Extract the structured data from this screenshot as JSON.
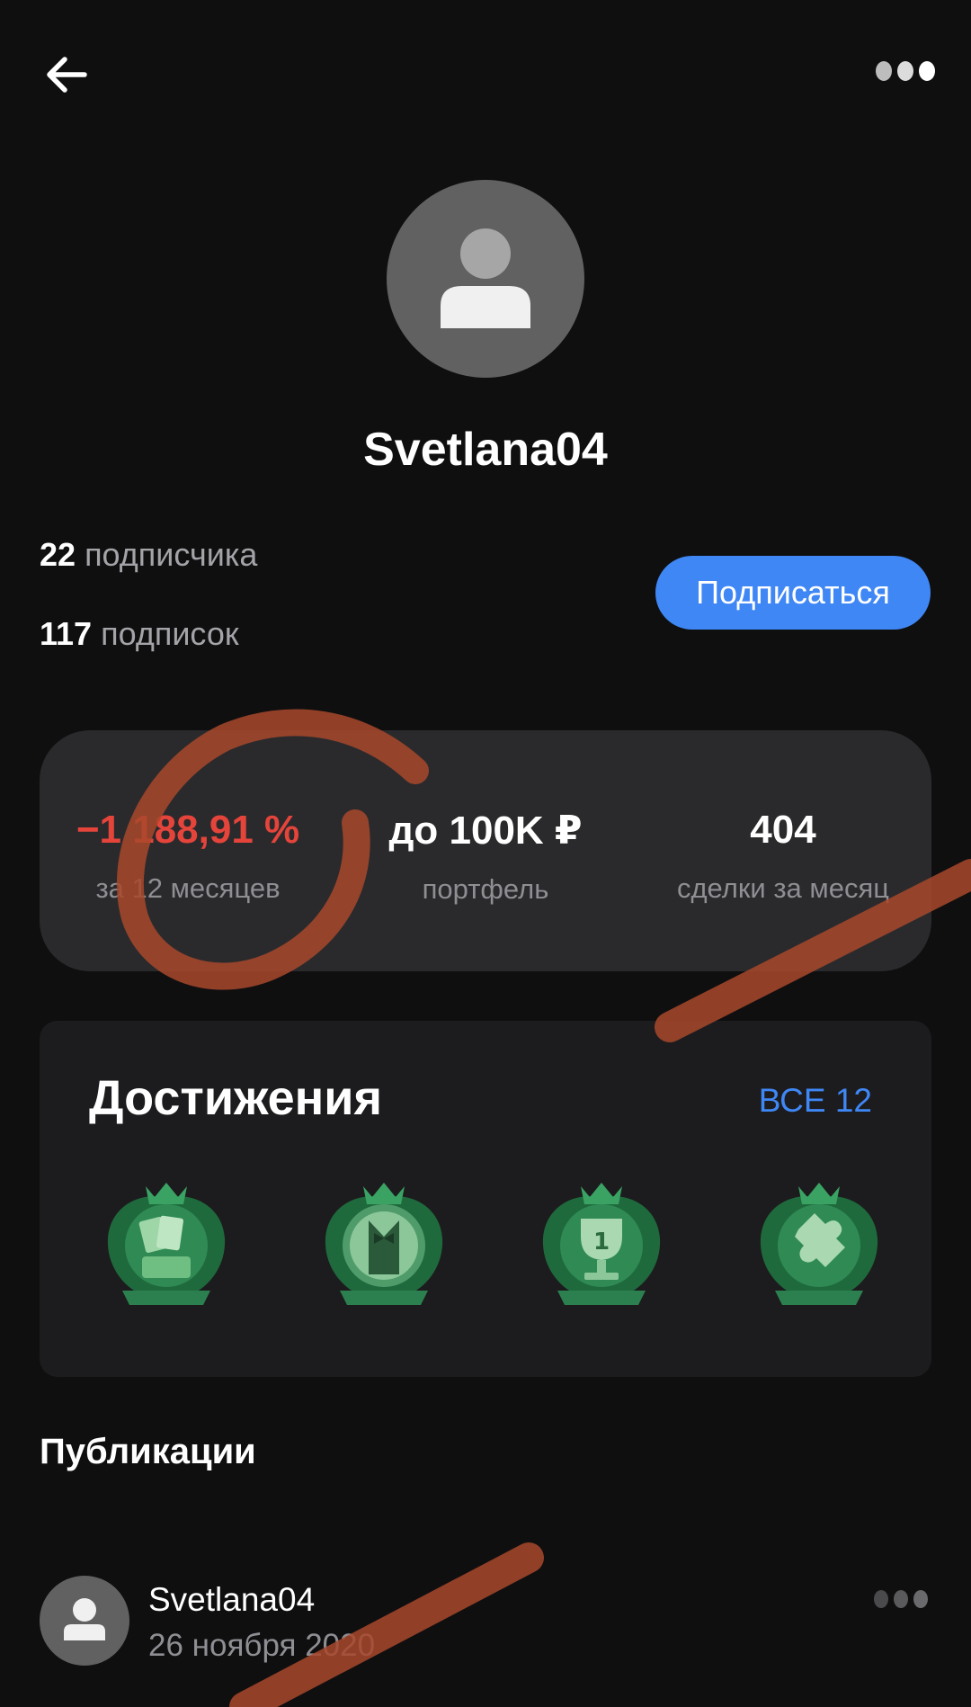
{
  "header": {
    "back_icon": "arrow-left-icon",
    "more_icon": "more-dots-icon"
  },
  "profile": {
    "username": "Svetlana04",
    "followers_count": "22",
    "followers_label": "подписчика",
    "following_count": "117",
    "following_label": "подписок",
    "subscribe_label": "Подписаться"
  },
  "stats": [
    {
      "value": "−1 188,91 %",
      "label": "за 12 месяцев",
      "color": "#e5443b"
    },
    {
      "value": "до 100K ₽",
      "label": "портфель",
      "color": "#ffffff"
    },
    {
      "value": "404",
      "label": "сделки за месяц",
      "color": "#ffffff"
    }
  ],
  "achievements": {
    "title": "Достижения",
    "all_label": "ВСЕ 12",
    "badges": [
      "cards-badge-icon",
      "tuxedo-badge-icon",
      "trophy-badge-icon",
      "puzzle-badge-icon"
    ]
  },
  "publications": {
    "title": "Публикации",
    "posts": [
      {
        "author": "Svetlana04",
        "date": "26 ноября 2020"
      }
    ]
  },
  "colors": {
    "accent": "#3f87f5",
    "negative": "#e5443b",
    "card": "#2a2a2c",
    "markup": "#a8482c"
  }
}
